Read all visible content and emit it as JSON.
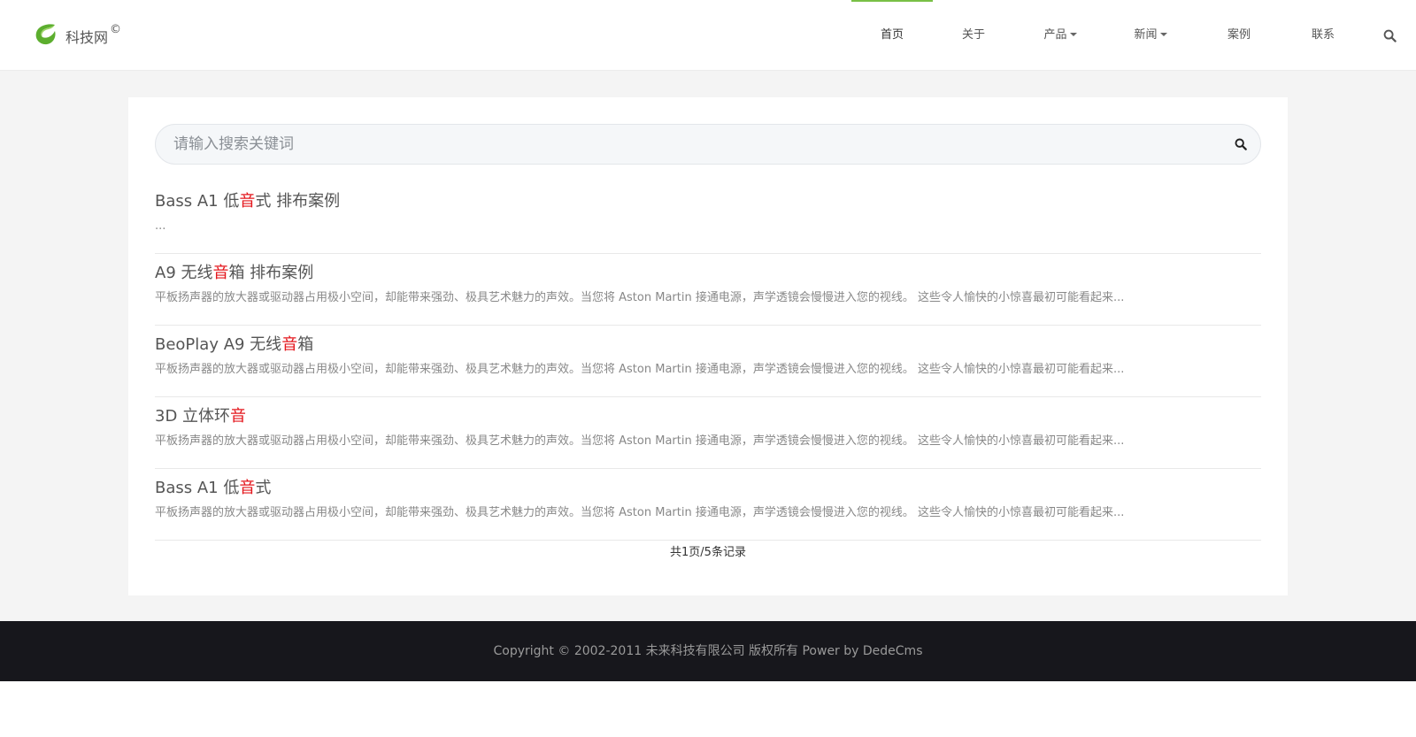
{
  "header": {
    "logo_text": "科技网",
    "logo_mark": "©",
    "nav": [
      {
        "label": "首页",
        "active": true,
        "dropdown": false
      },
      {
        "label": "关于",
        "active": false,
        "dropdown": false
      },
      {
        "label": "产品",
        "active": false,
        "dropdown": true
      },
      {
        "label": "新闻",
        "active": false,
        "dropdown": true
      },
      {
        "label": "案例",
        "active": false,
        "dropdown": false
      },
      {
        "label": "联系",
        "active": false,
        "dropdown": false
      }
    ],
    "search_icon": "search-icon"
  },
  "search": {
    "placeholder": "请输入搜索关键词",
    "value": "",
    "button_icon": "search-icon"
  },
  "results": [
    {
      "title_before": "Bass A1 低",
      "title_hl": "音",
      "title_after": "式 排布案例",
      "desc": "..."
    },
    {
      "title_before": "A9 无线",
      "title_hl": "音",
      "title_after": "箱 排布案例",
      "desc": "平板扬声器的放大器或驱动器占用极小空间，却能带来强劲、极具艺术魅力的声效。当您将 Aston Martin 接通电源，声学透镜会慢慢进入您的视线。 这些令人愉快的小惊喜最初可能看起来..."
    },
    {
      "title_before": "BeoPlay A9 无线",
      "title_hl": "音",
      "title_after": "箱",
      "desc": "平板扬声器的放大器或驱动器占用极小空间，却能带来强劲、极具艺术魅力的声效。当您将 Aston Martin 接通电源，声学透镜会慢慢进入您的视线。 这些令人愉快的小惊喜最初可能看起来..."
    },
    {
      "title_before": "3D 立体环",
      "title_hl": "音",
      "title_after": "",
      "desc": "平板扬声器的放大器或驱动器占用极小空间，却能带来强劲、极具艺术魅力的声效。当您将 Aston Martin 接通电源，声学透镜会慢慢进入您的视线。 这些令人愉快的小惊喜最初可能看起来..."
    },
    {
      "title_before": "Bass A1 低",
      "title_hl": "音",
      "title_after": "式",
      "desc": "平板扬声器的放大器或驱动器占用极小空间，却能带来强劲、极具艺术魅力的声效。当您将 Aston Martin 接通电源，声学透镜会慢慢进入您的视线。 这些令人愉快的小惊喜最初可能看起来..."
    }
  ],
  "pagination": {
    "text": "共1页/5条记录"
  },
  "footer": {
    "copyright": "Copyright © 2002-2011 未来科技有限公司 版权所有 Power by DedeCms"
  },
  "colors": {
    "accent": "#79c046",
    "highlight": "#e4161c",
    "footer_bg": "#17171c",
    "page_bg": "#f4f4f4"
  }
}
